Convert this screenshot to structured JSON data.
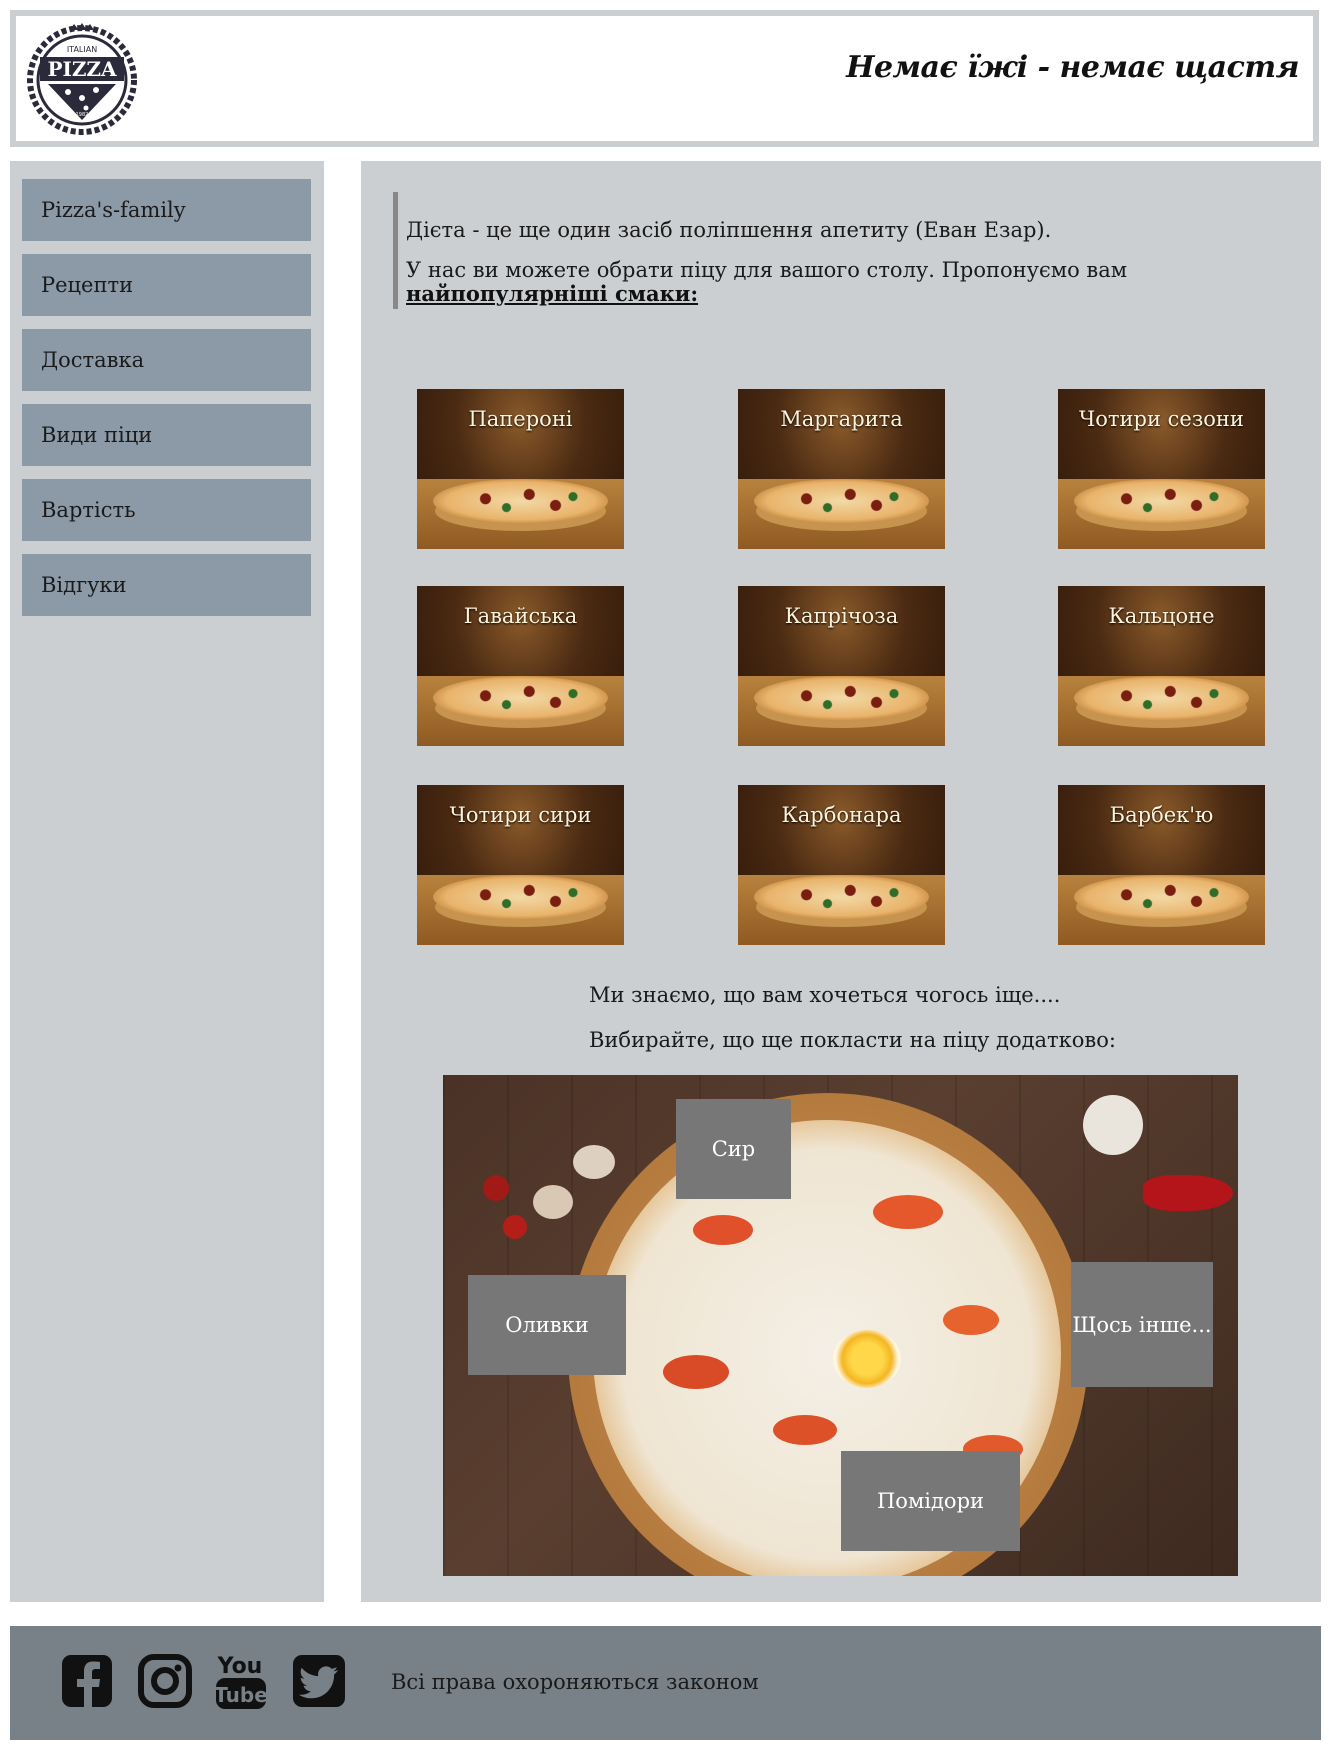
{
  "header": {
    "logo": {
      "top": "ITALIAN",
      "main": "PIZZA",
      "year": "1982"
    },
    "slogan": "Немає їжі - немає щастя"
  },
  "sidebar": {
    "items": [
      {
        "label": "Pizza's-family"
      },
      {
        "label": "Рецепти"
      },
      {
        "label": "Доставка"
      },
      {
        "label": "Види піци"
      },
      {
        "label": "Вартість"
      },
      {
        "label": "Відгуки"
      }
    ]
  },
  "main": {
    "quote": "Дієта - це ще один засіб поліпшення апетиту (Еван Езар).",
    "intro": "У нас ви можете обрати піцу для вашого столу. Пропонуємо вам ",
    "intro_link": "найпопулярніші смаки:",
    "pizzas": [
      {
        "name": "Папероні"
      },
      {
        "name": "Маргарита"
      },
      {
        "name": "Чотири сезони"
      },
      {
        "name": "Гавайська"
      },
      {
        "name": "Капрічоза"
      },
      {
        "name": "Кальцоне"
      },
      {
        "name": "Чотири сири"
      },
      {
        "name": "Карбонара"
      },
      {
        "name": "Барбек'ю"
      }
    ],
    "extra_line1": "Ми знаємо, що вам хочеться чогось іще....",
    "extra_line2": "Вибирайте, що ще покласти на піцу додатково:",
    "toppings": [
      {
        "label": "Сир"
      },
      {
        "label": "Оливки"
      },
      {
        "label": "Щось інше..."
      },
      {
        "label": "Помідори"
      }
    ]
  },
  "footer": {
    "social": [
      {
        "icon": "facebook-icon"
      },
      {
        "icon": "instagram-icon"
      },
      {
        "icon": "youtube-icon",
        "text_top": "You",
        "text_bottom": "Tube"
      },
      {
        "icon": "twitter-icon"
      }
    ],
    "copyright": "Всі права охороняються законом"
  }
}
